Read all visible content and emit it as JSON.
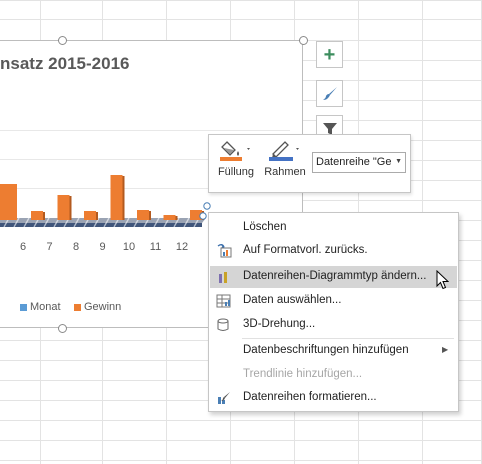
{
  "chart": {
    "title": "nsatz 2015-2016",
    "categories": [
      "6",
      "7",
      "8",
      "9",
      "10",
      "11",
      "12"
    ],
    "legend": [
      {
        "name": "Monat",
        "color": "#5b9bd5"
      },
      {
        "name": "Gewinn",
        "color": "#ed7d31"
      }
    ]
  },
  "chart_data": {
    "type": "bar",
    "title": "nsatz 2015-2016",
    "categories": [
      "6",
      "7",
      "8",
      "9",
      "10",
      "11",
      "12"
    ],
    "series": [
      {
        "name": "Monat",
        "values": [
          0,
          0,
          0,
          0,
          0,
          0,
          0
        ]
      },
      {
        "name": "Gewinn",
        "values": [
          0.9,
          2.5,
          0.9,
          4.5,
          1.0,
          0.5,
          1.0
        ]
      }
    ],
    "grid": true,
    "legend_position": "bottom",
    "colors": {
      "Monat": "#5b9bd5",
      "Gewinn": "#ed7d31"
    }
  },
  "side_buttons": [
    {
      "icon": "plus-icon"
    },
    {
      "icon": "brush-icon"
    },
    {
      "icon": "filter-icon"
    }
  ],
  "mini_toolbar": {
    "fill_label": "Füllung",
    "outline_label": "Rahmen",
    "series_select": "Datenreihe \"Ge",
    "fill_color": "#ed7d31",
    "outline_color": "#4472c4"
  },
  "context_menu": {
    "items": [
      {
        "label": "Löschen",
        "icon": "",
        "disabled": false
      },
      {
        "label": "Auf Formatvorl. zurücks.",
        "icon": "reset-style-icon",
        "disabled": false
      },
      {
        "label": "Datenreihen-Diagrammtyp ändern...",
        "icon": "chart-type-icon",
        "disabled": false,
        "hover": true
      },
      {
        "label": "Daten auswählen...",
        "icon": "select-data-icon",
        "disabled": false
      },
      {
        "label": "3D-Drehung...",
        "icon": "rotation-3d-icon",
        "disabled": false
      },
      {
        "label": "Datenbeschriftungen hinzufügen",
        "icon": "",
        "disabled": false,
        "submenu": true
      },
      {
        "label": "Trendlinie hinzufügen...",
        "icon": "",
        "disabled": true
      },
      {
        "label": "Datenreihen formatieren...",
        "icon": "format-series-icon",
        "disabled": false
      }
    ]
  }
}
